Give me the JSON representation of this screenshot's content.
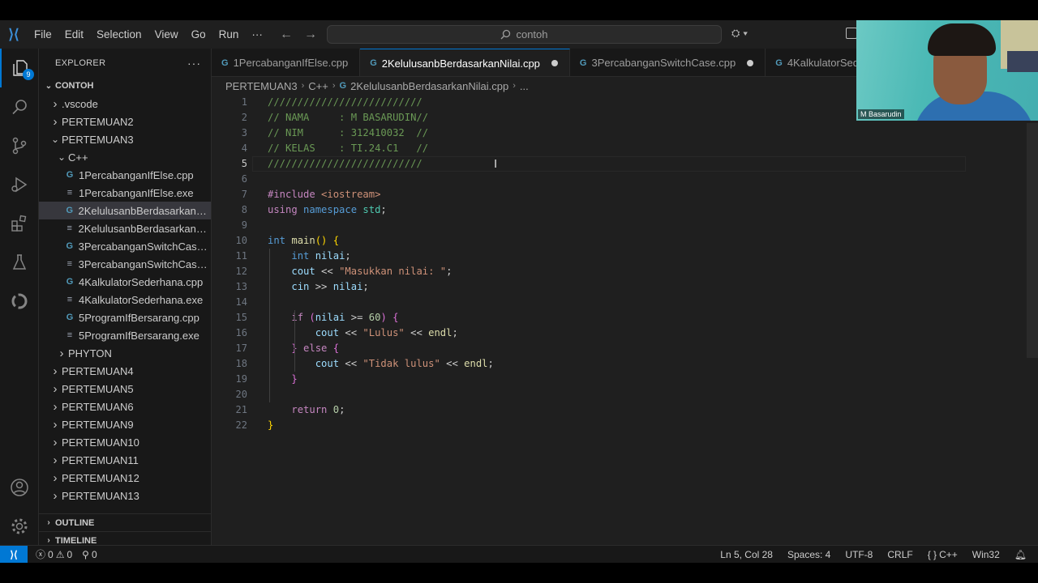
{
  "titlebar": {
    "menu": [
      "File",
      "Edit",
      "Selection",
      "View",
      "Go",
      "Run",
      "···"
    ],
    "search_text": "contoh"
  },
  "activitybar": {
    "explorer_badge": "9"
  },
  "sidebar": {
    "title": "EXPLORER",
    "actions": "···",
    "root": "CONTOH",
    "tree": [
      {
        "label": ".vscode",
        "depth": 1,
        "type": "folder",
        "open": false
      },
      {
        "label": "PERTEMUAN2",
        "depth": 1,
        "type": "folder",
        "open": false
      },
      {
        "label": "PERTEMUAN3",
        "depth": 1,
        "type": "folder",
        "open": true
      },
      {
        "label": "C++",
        "depth": 2,
        "type": "folder",
        "open": true
      },
      {
        "label": "1PercabanganIfElse.cpp",
        "depth": 3,
        "type": "cpp"
      },
      {
        "label": "1PercabanganIfElse.exe",
        "depth": 3,
        "type": "exe"
      },
      {
        "label": "2KelulusanbBerdasarkanNi...",
        "depth": 3,
        "type": "cpp",
        "selected": true
      },
      {
        "label": "2KelulusanbBerdasarkanNi...",
        "depth": 3,
        "type": "exe"
      },
      {
        "label": "3PercabanganSwitchCase....",
        "depth": 3,
        "type": "cpp"
      },
      {
        "label": "3PercabanganSwitchCase....",
        "depth": 3,
        "type": "exe"
      },
      {
        "label": "4KalkulatorSederhana.cpp",
        "depth": 3,
        "type": "cpp"
      },
      {
        "label": "4KalkulatorSederhana.exe",
        "depth": 3,
        "type": "exe"
      },
      {
        "label": "5ProgramIfBersarang.cpp",
        "depth": 3,
        "type": "cpp"
      },
      {
        "label": "5ProgramIfBersarang.exe",
        "depth": 3,
        "type": "exe"
      },
      {
        "label": "PHYTON",
        "depth": 2,
        "type": "folder",
        "open": false
      },
      {
        "label": "PERTEMUAN4",
        "depth": 1,
        "type": "folder",
        "open": false
      },
      {
        "label": "PERTEMUAN5",
        "depth": 1,
        "type": "folder",
        "open": false
      },
      {
        "label": "PERTEMUAN6",
        "depth": 1,
        "type": "folder",
        "open": false
      },
      {
        "label": "PERTEMUAN9",
        "depth": 1,
        "type": "folder",
        "open": false
      },
      {
        "label": "PERTEMUAN10",
        "depth": 1,
        "type": "folder",
        "open": false
      },
      {
        "label": "PERTEMUAN11",
        "depth": 1,
        "type": "folder",
        "open": false
      },
      {
        "label": "PERTEMUAN12",
        "depth": 1,
        "type": "folder",
        "open": false
      },
      {
        "label": "PERTEMUAN13",
        "depth": 1,
        "type": "folder",
        "open": false
      }
    ],
    "outline": "OUTLINE",
    "timeline": "TIMELINE"
  },
  "tabs": [
    {
      "label": "1PercabanganIfElse.cpp",
      "active": false,
      "dirty": false
    },
    {
      "label": "2KelulusanbBerdasarkanNilai.cpp",
      "active": true,
      "dirty": true
    },
    {
      "label": "3PercabanganSwitchCase.cpp",
      "active": false,
      "dirty": true
    },
    {
      "label": "4KalkulatorSed",
      "active": false,
      "dirty": false
    }
  ],
  "breadcrumb": {
    "parts": [
      "PERTEMUAN3",
      "C++",
      "2KelulusanbBerdasarkanNilai.cpp",
      "..."
    ]
  },
  "editor": {
    "current_line": 5,
    "lines": [
      [
        [
          "c-com",
          "//////////////////////////"
        ]
      ],
      [
        [
          "c-com",
          "// NAMA     : M BASARUDIN//"
        ]
      ],
      [
        [
          "c-com",
          "// NIM      : 312410032  //"
        ]
      ],
      [
        [
          "c-com",
          "// KELAS    : TI.24.C1   //"
        ]
      ],
      [
        [
          "c-com",
          "//////////////////////////"
        ]
      ],
      [],
      [
        [
          "c-ctrl",
          "#include "
        ],
        [
          "c-str",
          "<iostream>"
        ]
      ],
      [
        [
          "c-ctrl",
          "using "
        ],
        [
          "c-kw",
          "namespace "
        ],
        [
          "c-ns",
          "std"
        ],
        [
          "",
          ";"
        ]
      ],
      [],
      [
        [
          "c-kw",
          "int "
        ],
        [
          "c-fn",
          "main"
        ],
        [
          "c-br1",
          "() {"
        ]
      ],
      [
        [
          "",
          "    "
        ],
        [
          "c-kw",
          "int "
        ],
        [
          "c-var",
          "nilai"
        ],
        [
          "",
          ";"
        ]
      ],
      [
        [
          "",
          "    "
        ],
        [
          "c-var",
          "cout "
        ],
        [
          "",
          "<< "
        ],
        [
          "c-str",
          "\"Masukkan nilai: \""
        ],
        [
          "",
          ";"
        ]
      ],
      [
        [
          "",
          "    "
        ],
        [
          "c-var",
          "cin "
        ],
        [
          "",
          ">> "
        ],
        [
          "c-var",
          "nilai"
        ],
        [
          "",
          ";"
        ]
      ],
      [],
      [
        [
          "",
          "    "
        ],
        [
          "c-ctrl",
          "if "
        ],
        [
          "c-br2",
          "("
        ],
        [
          "c-var",
          "nilai "
        ],
        [
          "",
          ">= "
        ],
        [
          "c-num",
          "60"
        ],
        [
          "c-br2",
          ") {"
        ]
      ],
      [
        [
          "",
          "        "
        ],
        [
          "c-var",
          "cout "
        ],
        [
          "",
          "<< "
        ],
        [
          "c-str",
          "\"Lulus\" "
        ],
        [
          "",
          "<< "
        ],
        [
          "c-fn",
          "endl"
        ],
        [
          "",
          ";"
        ]
      ],
      [
        [
          "",
          "    "
        ],
        [
          "c-br2",
          "} "
        ],
        [
          "c-ctrl",
          "else "
        ],
        [
          "c-br2",
          "{"
        ]
      ],
      [
        [
          "",
          "        "
        ],
        [
          "c-var",
          "cout "
        ],
        [
          "",
          "<< "
        ],
        [
          "c-str",
          "\"Tidak lulus\" "
        ],
        [
          "",
          "<< "
        ],
        [
          "c-fn",
          "endl"
        ],
        [
          "",
          ";"
        ]
      ],
      [
        [
          "",
          "    "
        ],
        [
          "c-br2",
          "}"
        ]
      ],
      [],
      [
        [
          "",
          "    "
        ],
        [
          "c-ctrl",
          "return "
        ],
        [
          "c-num",
          "0"
        ],
        [
          "",
          ";"
        ]
      ],
      [
        [
          "c-br1",
          "}"
        ]
      ]
    ]
  },
  "statusbar": {
    "errors": "0",
    "warnings": "0",
    "ports": "0",
    "position": "Ln 5, Col 28",
    "spaces": "Spaces: 4",
    "encoding": "UTF-8",
    "eol": "CRLF",
    "language": "C++",
    "platform": "Win32"
  },
  "webcam": {
    "name": "M Basarudin"
  },
  "colors": {
    "accent": "#0078d4",
    "editor_bg": "#1f1f1f",
    "sidebar_bg": "#181818"
  }
}
